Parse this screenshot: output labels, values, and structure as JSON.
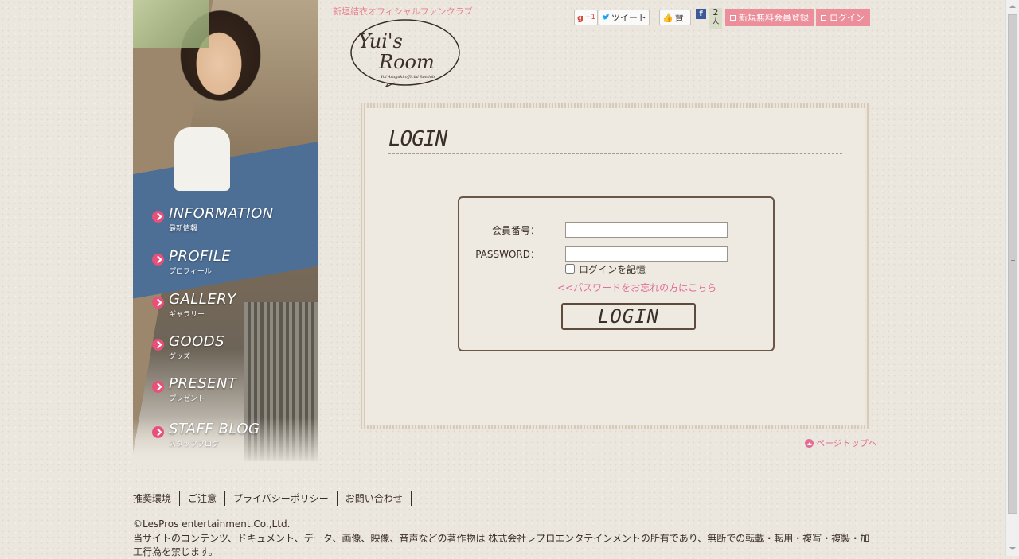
{
  "header": {
    "site_tagline": "新垣結衣オフィシャルファンクラブ",
    "logo_text_1": "Yui's",
    "logo_text_2": "Room",
    "logo_subtext": "Yui Aragaki official fanclub",
    "social": {
      "gplus_label": "+1",
      "tweet_label": "ツイート",
      "like_label": "賛",
      "fb_count": "2",
      "fb_unit": "人"
    },
    "register_button": "新規無料会員登録",
    "login_button": "ログイン"
  },
  "nav": {
    "items": [
      {
        "en": "INFORMATION",
        "ja": "最新情報"
      },
      {
        "en": "PROFILE",
        "ja": "プロフィール"
      },
      {
        "en": "GALLERY",
        "ja": "ギャラリー"
      },
      {
        "en": "GOODS",
        "ja": "グッズ"
      },
      {
        "en": "PRESENT",
        "ja": "プレゼント"
      },
      {
        "en": "STAFF BLOG",
        "ja": "スタッフブログ"
      }
    ]
  },
  "login": {
    "title": "LOGIN",
    "member_number_label": "会員番号：",
    "member_number_value": "",
    "password_label": "PASSWORD：",
    "password_value": "",
    "remember_label": "ログインを記憶",
    "remember_checked": false,
    "forgot_link": "<<パスワードをお忘れの方はこちら",
    "submit_label": "LOGIN"
  },
  "page_top": "ページトップへ",
  "footer": {
    "links": [
      "推奨環境",
      "ご注意",
      "プライバシーポリシー",
      "お問い合わせ"
    ],
    "copyright": "©LesPros entertainment.Co.,Ltd.",
    "notice": "当サイトのコンテンツ、ドキュメント、データ、画像、映像、音声などの著作物は 株式会社レプロエンタテインメントの所有であり、無断での転載・転用・複写・複製・加工行為を禁じます。"
  },
  "colors": {
    "accent_pink": "#e8507a",
    "button_pink": "#ec8f9b",
    "text_brown": "#3a2f28",
    "background": "#ece7de"
  }
}
